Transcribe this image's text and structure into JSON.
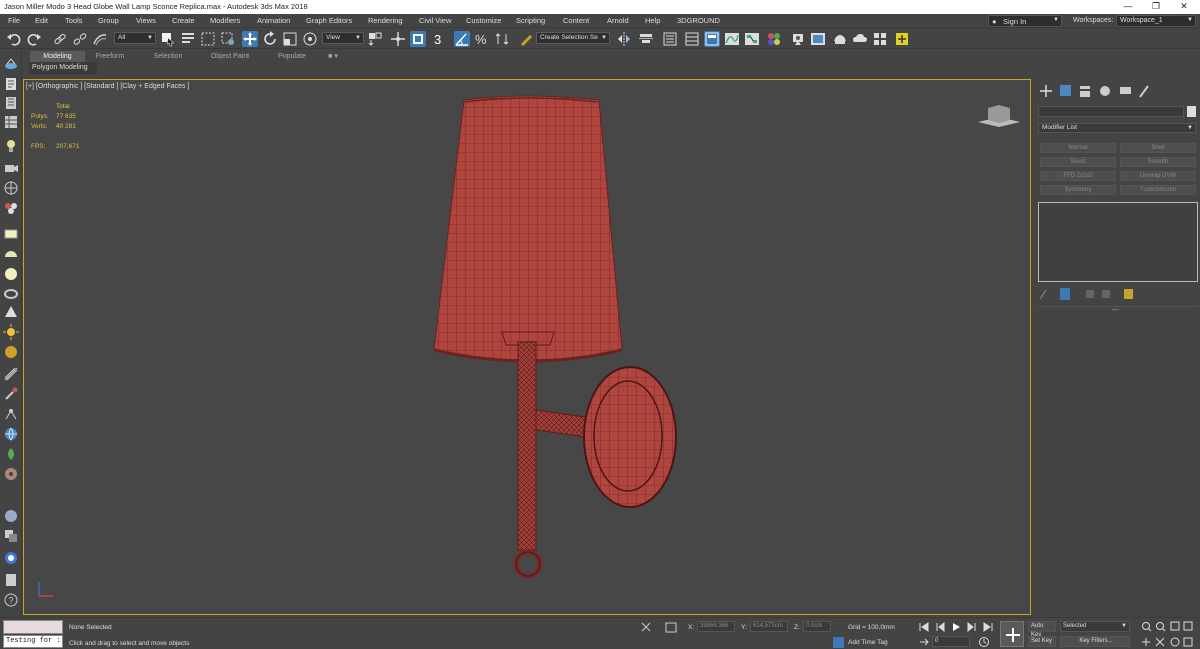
{
  "window": {
    "title": "Jason Miller Modo 3 Head Globe Wall Lamp Sconce Replica.max - Autodesk 3ds Max 2018",
    "minimize": "—",
    "restore": "❐",
    "close": "✕"
  },
  "menu": {
    "items": [
      "File",
      "Edit",
      "Tools",
      "Group",
      "Views",
      "Create",
      "Modifiers",
      "Animation",
      "Graph Editors",
      "Rendering",
      "Civil View",
      "Customize",
      "Scripting",
      "Content",
      "Arnold",
      "Help",
      "3DGROUND"
    ],
    "sign_in": "Sign In",
    "workspaces_label": "Workspaces:",
    "workspace_value": "Workspace_1"
  },
  "toolbar": {
    "selection_filter": "All",
    "ref_coord": "View",
    "selection_set": "Create Selection Se",
    "snap_label": "3"
  },
  "ribbon": {
    "tabs": [
      "Modeling",
      "Freeform",
      "Selection",
      "Object Paint",
      "Populate"
    ],
    "active_tab": "Modeling",
    "sub_label": "Polygon Modeling"
  },
  "viewport": {
    "label": "[+] [Orthographic ] [Standard ] [Clay + Edged Faces ]",
    "stats": {
      "total_label": "Total",
      "polys_label": "Polys:",
      "polys_value": "77 635",
      "verts_label": "Verts:",
      "verts_value": "40 281",
      "fps_label": "FPS:",
      "fps_value": "207,671"
    },
    "colors": {
      "background": "#474747",
      "border": "#c9a227",
      "model_fill": "#b0453f",
      "model_wire": "#5a1c1a"
    }
  },
  "command_panel": {
    "modifier_list": "Modifier List",
    "buttons": [
      "Normal",
      "Shell",
      "Bend",
      "Smooth",
      "FFD 2x2x2",
      "Unwrap UVW",
      "Symmetry",
      "TurboSmooth"
    ]
  },
  "status": {
    "selection": "None Selected",
    "prompt": "Click and drag to select and move objects",
    "maxscript": "Testing for :",
    "x_label": "X:",
    "y_label": "Y:",
    "z_label": "Z:",
    "x_value": "39866,366",
    "y_value": "614,573cm",
    "z_value": "0,0cm",
    "grid": "Grid = 100,0mm",
    "add_time_tag": "Add Time Tag",
    "auto_key": "Auto Key",
    "set_key": "Set Key",
    "key_mode": "Selected",
    "key_filters": "Key Filters...",
    "frame": "0"
  }
}
